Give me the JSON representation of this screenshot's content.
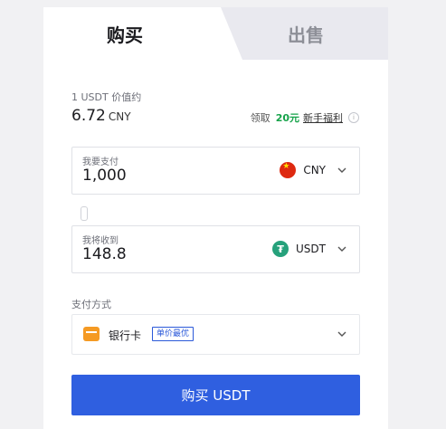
{
  "tabs": {
    "buy": "购买",
    "sell": "出售"
  },
  "rate": {
    "caption": "1 USDT 价值约",
    "value": "6.72",
    "unit": "CNY"
  },
  "promo": {
    "prefix": "领取",
    "amount": "20元",
    "link": "新手福利"
  },
  "pay": {
    "label": "我要支付",
    "amount": "1,000",
    "currency": "CNY"
  },
  "receive": {
    "label": "我将收到",
    "amount": "148.8",
    "currency": "USDT"
  },
  "payment_method": {
    "caption": "支付方式",
    "name": "银行卡",
    "badge": "单价最优"
  },
  "button": {
    "label": "购买 USDT"
  },
  "colors": {
    "primary": "#2f5fe0",
    "accent_green": "#16a34a",
    "tether": "#26a17b",
    "cny_red": "#de2910"
  }
}
